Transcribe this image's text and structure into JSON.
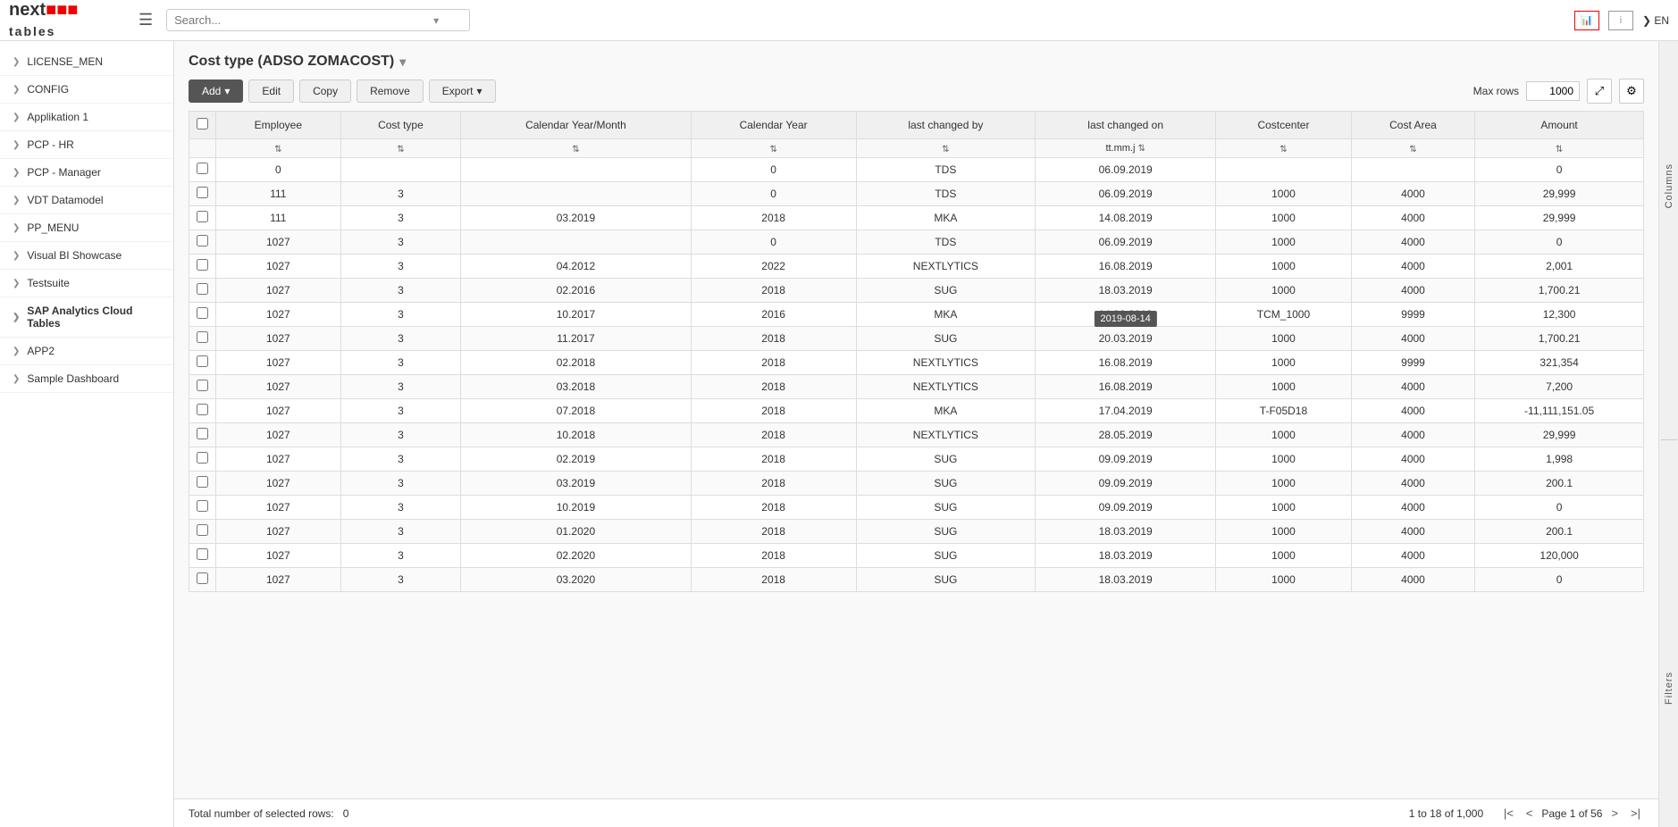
{
  "topbar": {
    "logo_text": "next",
    "logo_sub": "tables",
    "hamburger_label": "☰",
    "search_placeholder": "Search...",
    "lang_label": "EN",
    "chevron": "▾"
  },
  "sidebar": {
    "items": [
      {
        "id": "license-men",
        "label": "LICENSE_MEN"
      },
      {
        "id": "config",
        "label": "CONFIG"
      },
      {
        "id": "applikation-1",
        "label": "Applikation 1"
      },
      {
        "id": "pcp-hr",
        "label": "PCP - HR"
      },
      {
        "id": "pcp-manager",
        "label": "PCP - Manager"
      },
      {
        "id": "vdt-datamodel",
        "label": "VDT Datamodel"
      },
      {
        "id": "pp-menu",
        "label": "PP_MENU"
      },
      {
        "id": "visual-showcase",
        "label": "Visual BI Showcase"
      },
      {
        "id": "testsuite",
        "label": "Testsuite"
      },
      {
        "id": "sap-analytics",
        "label": "SAP Analytics Cloud Tables",
        "active": true
      },
      {
        "id": "app2",
        "label": "APP2"
      },
      {
        "id": "sample-dashboard",
        "label": "Sample Dashboard"
      }
    ]
  },
  "table_section": {
    "title": "Cost type (ADSO ZOMACOST)",
    "dropdown_icon": "▾",
    "toolbar": {
      "add_label": "Add",
      "edit_label": "Edit",
      "copy_label": "Copy",
      "remove_label": "Remove",
      "export_label": "Export"
    },
    "max_rows_label": "Max rows",
    "max_rows_value": "1000",
    "columns": [
      {
        "id": "employee",
        "label": "Employee",
        "filter": true
      },
      {
        "id": "cost_type",
        "label": "Cost type",
        "filter": true
      },
      {
        "id": "cal_year_month",
        "label": "Calendar Year/Month",
        "filter": true
      },
      {
        "id": "cal_year",
        "label": "Calendar Year",
        "filter": true
      },
      {
        "id": "last_changed_by",
        "label": "last changed by",
        "filter": true
      },
      {
        "id": "last_changed_on",
        "label": "last changed on",
        "filter_text": "tt.mm.j",
        "filter": true
      },
      {
        "id": "costcenter",
        "label": "Costcenter",
        "filter": true
      },
      {
        "id": "cost_area",
        "label": "Cost Area",
        "filter": true
      },
      {
        "id": "amount",
        "label": "Amount",
        "filter": true
      }
    ],
    "rows": [
      {
        "employee": "0",
        "cost_type": "",
        "cal_year_month": "",
        "cal_year": "0",
        "last_changed_by": "TDS",
        "last_changed_on": "06.09.2019",
        "costcenter": "",
        "cost_area": "",
        "amount": "0"
      },
      {
        "employee": "111",
        "cost_type": "3",
        "cal_year_month": "",
        "cal_year": "0",
        "last_changed_by": "TDS",
        "last_changed_on": "06.09.2019",
        "costcenter": "1000",
        "cost_area": "4000",
        "amount": "29,999"
      },
      {
        "employee": "111",
        "cost_type": "3",
        "cal_year_month": "03.2019",
        "cal_year": "2018",
        "last_changed_by": "MKA",
        "last_changed_on": "14.08.2019",
        "costcenter": "1000",
        "cost_area": "4000",
        "amount": "29,999"
      },
      {
        "employee": "1027",
        "cost_type": "3",
        "cal_year_month": "",
        "cal_year": "0",
        "last_changed_by": "TDS",
        "last_changed_on": "06.09.2019",
        "costcenter": "1000",
        "cost_area": "4000",
        "amount": "0"
      },
      {
        "employee": "1027",
        "cost_type": "3",
        "cal_year_month": "04.2012",
        "cal_year": "2022",
        "last_changed_by": "NEXTLYTICS",
        "last_changed_on": "16.08.2019",
        "costcenter": "1000",
        "cost_area": "4000",
        "amount": "2,001"
      },
      {
        "employee": "1027",
        "cost_type": "3",
        "cal_year_month": "02.2016",
        "cal_year": "2018",
        "last_changed_by": "SUG",
        "last_changed_on": "18.03.2019",
        "costcenter": "1000",
        "cost_area": "4000",
        "amount": "1,700.21"
      },
      {
        "employee": "1027",
        "cost_type": "3",
        "cal_year_month": "10.2017",
        "cal_year": "2016",
        "last_changed_by": "MKA",
        "last_changed_on": "14.08.2019",
        "costcenter": "TCM_1000",
        "cost_area": "9999",
        "amount": "12,300"
      },
      {
        "employee": "1027",
        "cost_type": "3",
        "cal_year_month": "11.2017",
        "cal_year": "2018",
        "last_changed_by": "SUG",
        "last_changed_on": "20.03.2019",
        "costcenter": "1000",
        "cost_area": "4000",
        "amount": "1,700.21",
        "tooltip": "2019-08-14"
      },
      {
        "employee": "1027",
        "cost_type": "3",
        "cal_year_month": "02.2018",
        "cal_year": "2018",
        "last_changed_by": "NEXTLYTICS",
        "last_changed_on": "16.08.2019",
        "costcenter": "1000",
        "cost_area": "9999",
        "amount": "321,354"
      },
      {
        "employee": "1027",
        "cost_type": "3",
        "cal_year_month": "03.2018",
        "cal_year": "2018",
        "last_changed_by": "NEXTLYTICS",
        "last_changed_on": "16.08.2019",
        "costcenter": "1000",
        "cost_area": "4000",
        "amount": "7,200"
      },
      {
        "employee": "1027",
        "cost_type": "3",
        "cal_year_month": "07.2018",
        "cal_year": "2018",
        "last_changed_by": "MKA",
        "last_changed_on": "17.04.2019",
        "costcenter": "T-F05D18",
        "cost_area": "4000",
        "amount": "-11,111,151.05"
      },
      {
        "employee": "1027",
        "cost_type": "3",
        "cal_year_month": "10.2018",
        "cal_year": "2018",
        "last_changed_by": "NEXTLYTICS",
        "last_changed_on": "28.05.2019",
        "costcenter": "1000",
        "cost_area": "4000",
        "amount": "29,999"
      },
      {
        "employee": "1027",
        "cost_type": "3",
        "cal_year_month": "02.2019",
        "cal_year": "2018",
        "last_changed_by": "SUG",
        "last_changed_on": "09.09.2019",
        "costcenter": "1000",
        "cost_area": "4000",
        "amount": "1,998"
      },
      {
        "employee": "1027",
        "cost_type": "3",
        "cal_year_month": "03.2019",
        "cal_year": "2018",
        "last_changed_by": "SUG",
        "last_changed_on": "09.09.2019",
        "costcenter": "1000",
        "cost_area": "4000",
        "amount": "200.1"
      },
      {
        "employee": "1027",
        "cost_type": "3",
        "cal_year_month": "10.2019",
        "cal_year": "2018",
        "last_changed_by": "SUG",
        "last_changed_on": "09.09.2019",
        "costcenter": "1000",
        "cost_area": "4000",
        "amount": "0"
      },
      {
        "employee": "1027",
        "cost_type": "3",
        "cal_year_month": "01.2020",
        "cal_year": "2018",
        "last_changed_by": "SUG",
        "last_changed_on": "18.03.2019",
        "costcenter": "1000",
        "cost_area": "4000",
        "amount": "200.1"
      },
      {
        "employee": "1027",
        "cost_type": "3",
        "cal_year_month": "02.2020",
        "cal_year": "2018",
        "last_changed_by": "SUG",
        "last_changed_on": "18.03.2019",
        "costcenter": "1000",
        "cost_area": "4000",
        "amount": "120,000"
      },
      {
        "employee": "1027",
        "cost_type": "3",
        "cal_year_month": "03.2020",
        "cal_year": "2018",
        "last_changed_by": "SUG",
        "last_changed_on": "18.03.2019",
        "costcenter": "1000",
        "cost_area": "4000",
        "amount": "0"
      }
    ]
  },
  "footer": {
    "selected_rows_label": "Total number of selected rows:",
    "selected_rows_value": "0",
    "pagination_info": "1 to 18 of 1,000",
    "page_info": "Page 1 of 56",
    "first_btn": "|<",
    "prev_btn": "<",
    "next_btn": ">",
    "last_btn": ">|"
  },
  "right_panel": {
    "columns_label": "Columns",
    "filters_label": "Filters"
  }
}
